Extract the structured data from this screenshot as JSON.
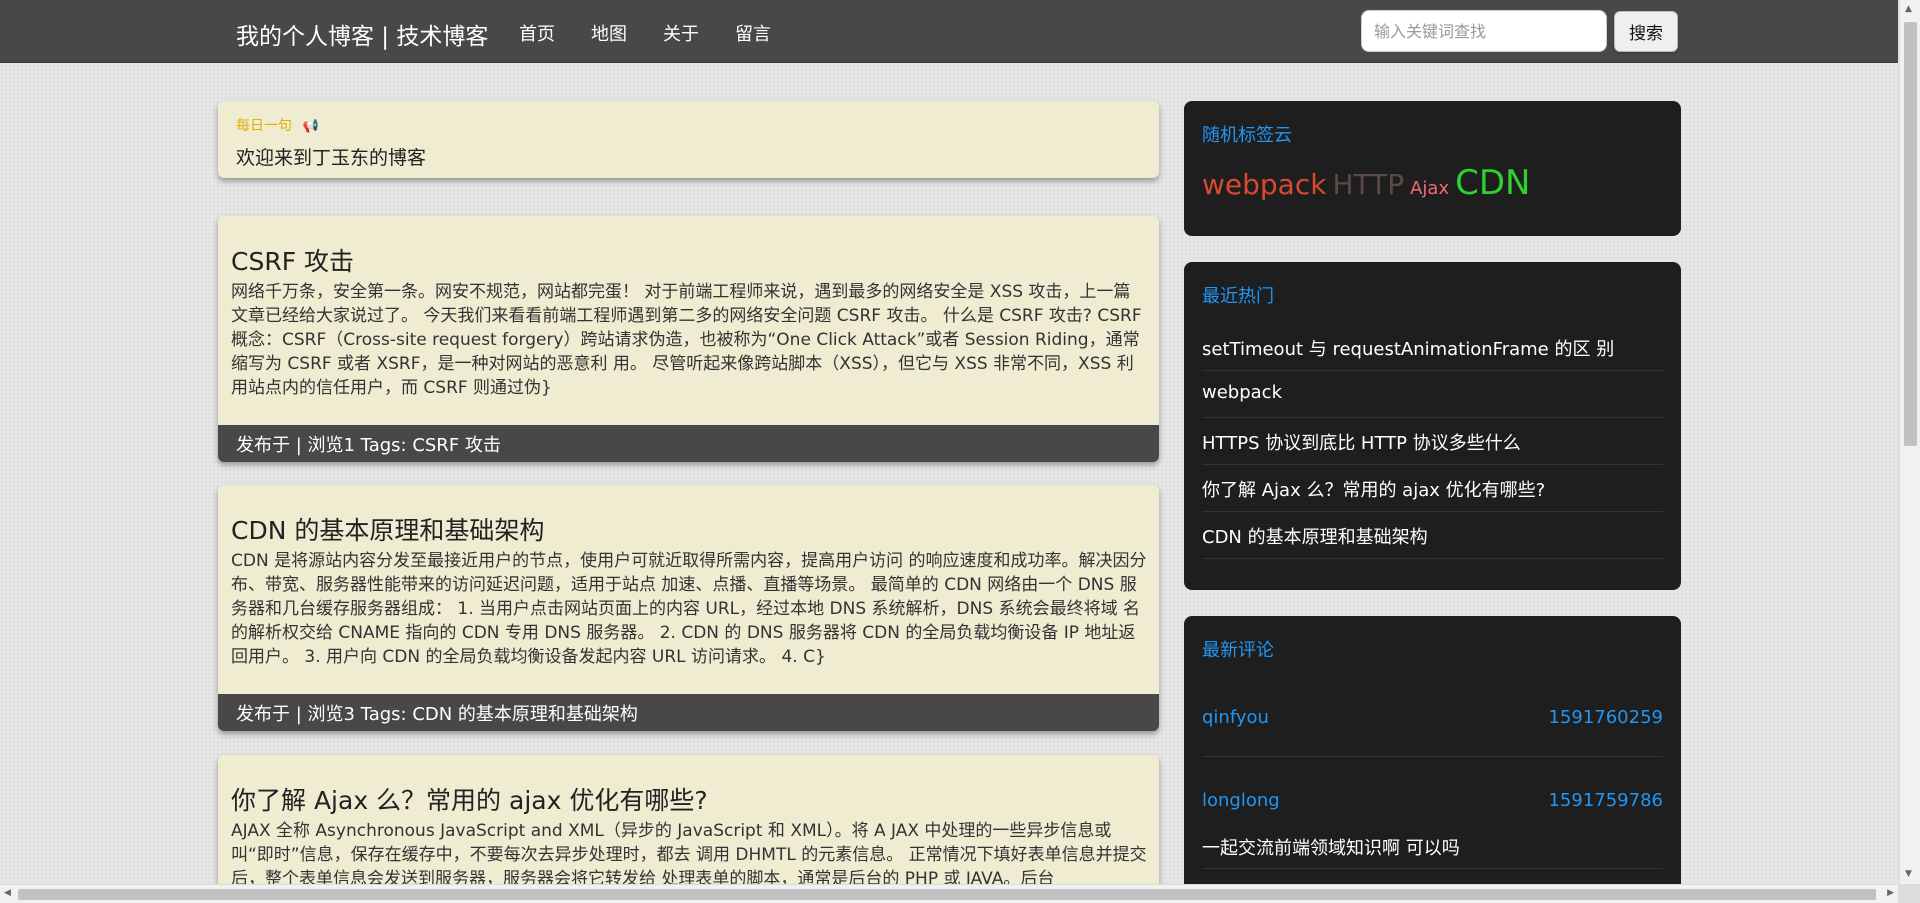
{
  "header": {
    "brand": "我的个人博客 | 技术博客",
    "nav": [
      "首页",
      "地图",
      "关于",
      "留言"
    ],
    "search_placeholder": "输入关键词查找",
    "search_button": "搜索"
  },
  "daily": {
    "label": "每日一句",
    "icon": "megaphone-icon",
    "text": "欢迎来到丁玉东的博客"
  },
  "posts": [
    {
      "title": "CSRF 攻击",
      "excerpt": "网络千万条，安全第一条。网安不规范，网站都完蛋！ 对于前端工程师来说，遇到最多的网络安全是 XSS 攻击，上一篇文章已经给大家说过了。 今天我们来看看前端工程师遇到第二多的网络安全问题 CSRF 攻击。 什么是 CSRF 攻击? CSRF 概念：CSRF（Cross-site request forgery）跨站请求伪造，也被称为“One Click Attack”或者 Session Riding，通常缩写为 CSRF 或者 XSRF，是一种对网站的恶意利 用。 尽管听起来像跨站脚本（XSS），但它与 XSS 非常不同，XSS 利用站点内的信任用户，而 CSRF 则通过伪}",
      "meta": "发布于 | 浏览1 Tags: CSRF 攻击"
    },
    {
      "title": "CDN 的基本原理和基础架构",
      "excerpt": "CDN 是将源站内容分发至最接近用户的节点，使用户可就近取得所需内容，提高用户访问 的响应速度和成功率。解决因分布、带宽、服务器性能带来的访问延迟问题，适用于站点 加速、点播、直播等场景。 最简单的 CDN 网络由一个 DNS 服务器和几台缓存服务器组成： 1. 当用户点击网站页面上的内容 URL，经过本地 DNS 系统解析，DNS 系统会最终将域 名的解析权交给 CNAME 指向的 CDN 专用 DNS 服务器。 2. CDN 的 DNS 服务器将 CDN 的全局负载均衡设备 IP 地址返回用户。 3. 用户向 CDN 的全局负载均衡设备发起内容 URL 访问请求。 4. C}",
      "meta": "发布于 | 浏览3 Tags: CDN 的基本原理和基础架构"
    },
    {
      "title": "你了解 Ajax 么？常用的 ajax 优化有哪些?",
      "excerpt": "AJAX 全称 Asynchronous JavaScript and XML（异步的 JavaScript 和 XML）。将 A JAX 中处理的一些异步信息或叫“即时”信息，保存在缓存中，不要每次去异步处理时，都去 调用 DHMTL 的元素信息。 正常情况下填好表单信息并提交后，整个表单信息会发送到服务器，服务器会将它转发给 处理表单的脚本，通常是后台的 PHP 或 JAVA。后台",
      "meta": ""
    }
  ],
  "sidebar": {
    "tag_cloud": {
      "title": "随机标签云",
      "tags": [
        {
          "text": "webpack",
          "color": "#d64933"
        },
        {
          "text": "HTTP",
          "color": "#5a4a44"
        },
        {
          "text": "Ajax",
          "color": "#f06a7a"
        },
        {
          "text": "CDN",
          "color": "#2ed12e"
        }
      ]
    },
    "hot": {
      "title": "最近热门",
      "items": [
        "setTimeout 与 requestAnimationFrame 的区 别",
        "webpack",
        "HTTPS 协议到底比 HTTP 协议多些什么",
        "你了解 Ajax 么？常用的 ajax 优化有哪些?",
        "CDN 的基本原理和基础架构"
      ]
    },
    "comments": {
      "title": "最新评论",
      "items": [
        {
          "user": "qinfyou",
          "time": "1591760259",
          "text": ""
        },
        {
          "user": "longlong",
          "time": "1591759786",
          "text": "一起交流前端领域知识啊 可以吗"
        }
      ]
    }
  }
}
